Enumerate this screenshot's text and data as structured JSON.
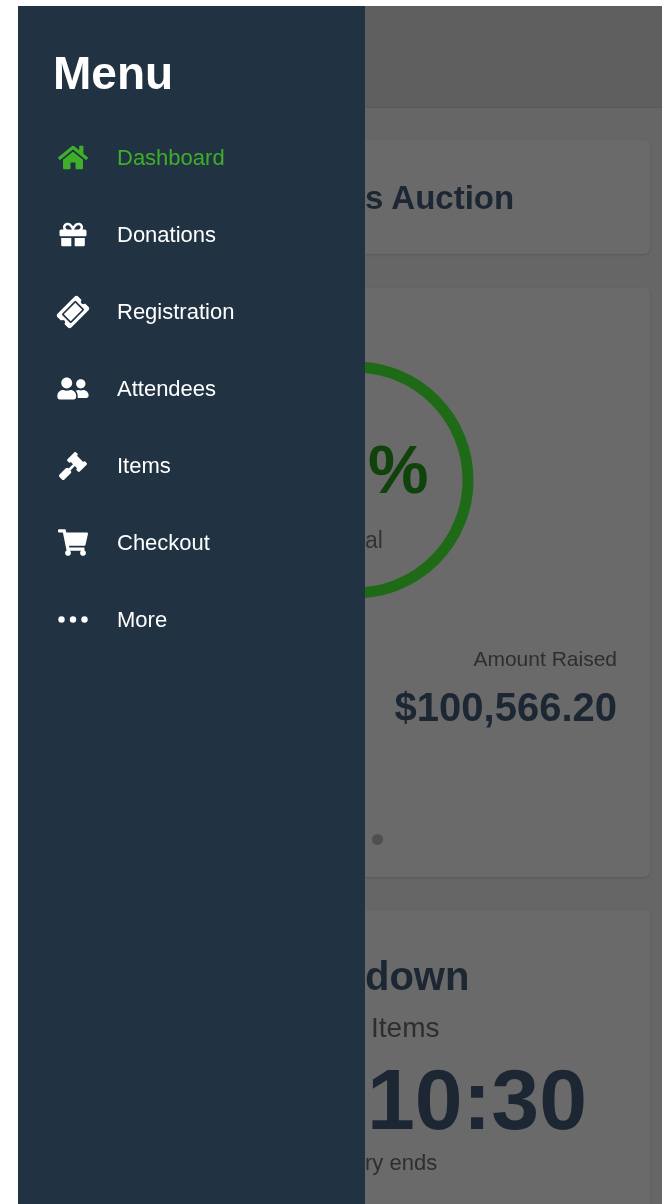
{
  "menu": {
    "title": "Menu",
    "items": [
      {
        "label": "Dashboard",
        "selected": true
      },
      {
        "label": "Donations",
        "selected": false
      },
      {
        "label": "Registration",
        "selected": false
      },
      {
        "label": "Attendees",
        "selected": false
      },
      {
        "label": "Items",
        "selected": false
      },
      {
        "label": "Checkout",
        "selected": false
      },
      {
        "label": "More",
        "selected": false
      }
    ]
  },
  "page": {
    "event_card": {
      "title": "s Auction"
    },
    "goal_card": {
      "percent": "%",
      "caption": "al",
      "amount_label": "Amount Raised",
      "amount": "$100,566.20"
    },
    "countdown_card": {
      "title": "down",
      "subtitle": "Items",
      "time": "10:30",
      "caption": "ry ends"
    }
  }
}
